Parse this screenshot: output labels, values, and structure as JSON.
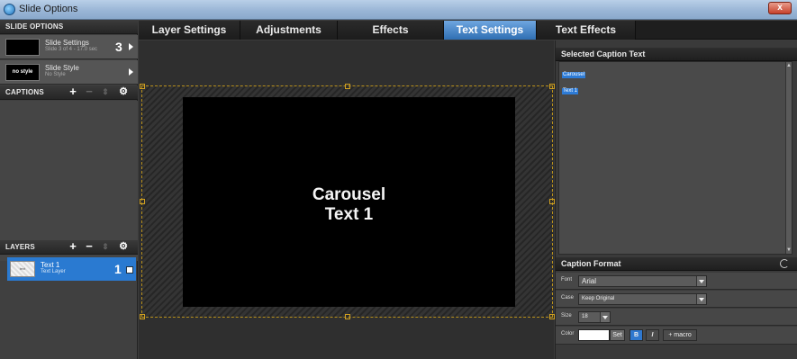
{
  "window": {
    "title": "Slide Options",
    "close_glyph": "x"
  },
  "sidebar": {
    "slide_options_header": "SLIDE OPTIONS",
    "slide_settings": {
      "title": "Slide Settings",
      "subtitle": "Slide 3 of 4 - 17.0 sec",
      "number": "3"
    },
    "slide_style": {
      "thumb_text": "no style",
      "title": "Slide Style",
      "subtitle": "No Style"
    },
    "captions_header": "CAPTIONS",
    "layers_header": "LAYERS",
    "tool_icons": {
      "add": "+",
      "remove": "−",
      "move": "⇕",
      "gear": "⚙"
    },
    "layer": {
      "thumb_text": "text",
      "title": "Text 1",
      "subtitle": "Text Layer",
      "number": "1"
    }
  },
  "tabs": [
    {
      "label": "Layer Settings"
    },
    {
      "label": "Adjustments"
    },
    {
      "label": "Effects"
    },
    {
      "label": "Text Settings",
      "active": true
    },
    {
      "label": "Text Effects"
    }
  ],
  "canvas": {
    "caption_line1": "Carousel",
    "caption_line2": "Text 1"
  },
  "right_panel": {
    "selected_caption_header": "Selected Caption Text",
    "selected_text_line1": "Carousel",
    "selected_text_line2": "Text 1",
    "caption_format_header": "Caption Format",
    "font_label": "Font",
    "font_value": "Arial",
    "case_label": "Case",
    "case_value": "Keep Original",
    "size_label": "Size",
    "size_value": "18",
    "color_label": "Color",
    "set_label": "Set",
    "bold_label": "B",
    "italic_label": "I",
    "macro_label": "+ macro"
  },
  "colors": {
    "accent": "#2f78cf",
    "guide": "#b8901c"
  }
}
